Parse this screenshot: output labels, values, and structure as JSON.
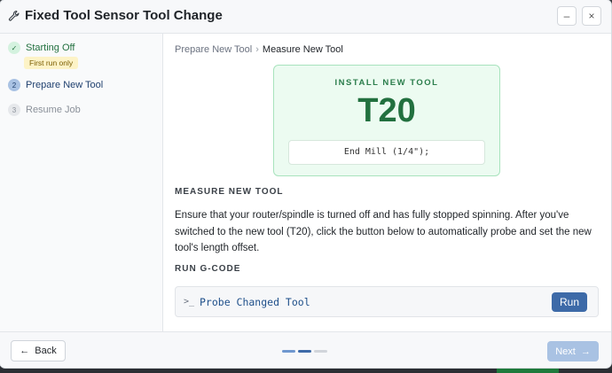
{
  "window": {
    "title": "Fixed Tool Sensor Tool Change",
    "minimize_label": "–",
    "close_label": "×"
  },
  "sidebar": {
    "steps": [
      {
        "number": "✓",
        "label": "Starting Off",
        "badge": "First run only",
        "state": "complete"
      },
      {
        "number": "2",
        "label": "Prepare New Tool",
        "state": "active"
      },
      {
        "number": "3",
        "label": "Resume Job",
        "state": "pending"
      }
    ]
  },
  "breadcrumb": {
    "items": [
      "Prepare New Tool",
      "Measure New Tool"
    ],
    "separator": "›"
  },
  "tool_card": {
    "heading": "INSTALL NEW TOOL",
    "tool_number": "T20",
    "description": "End Mill (1/4\");"
  },
  "measure": {
    "heading": "MEASURE NEW TOOL",
    "text": "Ensure that your router/spindle is turned off and has fully stopped spinning. After you've switched to the new tool (T20), click the button below to automatically probe and set the new tool's length offset."
  },
  "gcode": {
    "heading": "RUN G-CODE",
    "prompt": ">_",
    "name": "Probe Changed Tool",
    "run_label": "Run"
  },
  "footer": {
    "back_label": "Back",
    "next_label": "Next",
    "progress_steps": 3,
    "progress_current": 2
  },
  "colors": {
    "accent": "#3d6aa8",
    "success": "#22703f",
    "progress_done": "#6f97cf",
    "progress_active": "#3d6aa8",
    "progress_pending": "#d1d5db"
  }
}
